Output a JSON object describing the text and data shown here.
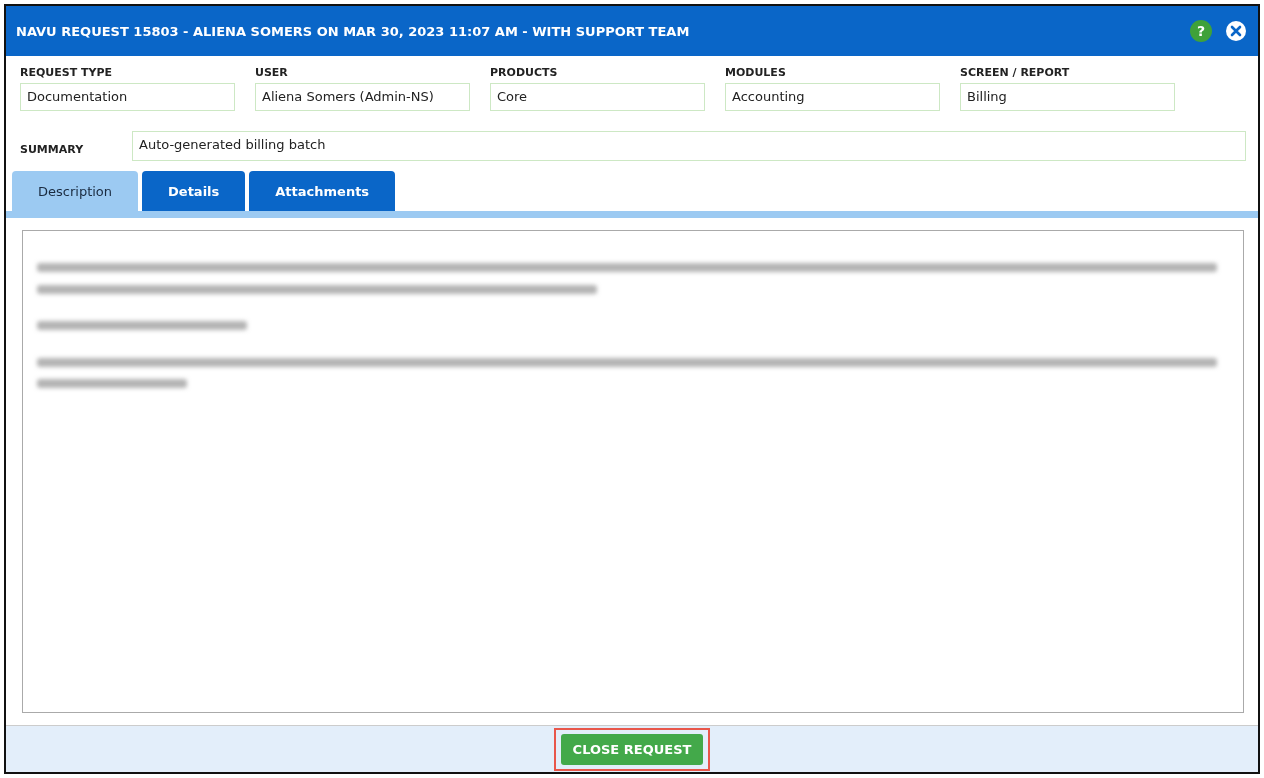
{
  "window": {
    "title": "NAVU REQUEST 15803 - ALIENA SOMERS ON MAR 30, 2023 11:07 AM - WITH SUPPORT TEAM",
    "help_icon": "?"
  },
  "fields": [
    {
      "label": "REQUEST TYPE",
      "value": "Documentation"
    },
    {
      "label": "USER",
      "value": "Aliena Somers (Admin-NS)"
    },
    {
      "label": "PRODUCTS",
      "value": "Core"
    },
    {
      "label": "MODULES",
      "value": "Accounting"
    },
    {
      "label": "SCREEN / REPORT",
      "value": "Billing"
    }
  ],
  "summary": {
    "label": "SUMMARY",
    "value": "Auto-generated billing batch"
  },
  "tabs": [
    {
      "label": "Description",
      "selected": true
    },
    {
      "label": "Details",
      "selected": false
    },
    {
      "label": "Attachments",
      "selected": false
    }
  ],
  "footer": {
    "button": "CLOSE REQUEST",
    "highlighted": true
  }
}
